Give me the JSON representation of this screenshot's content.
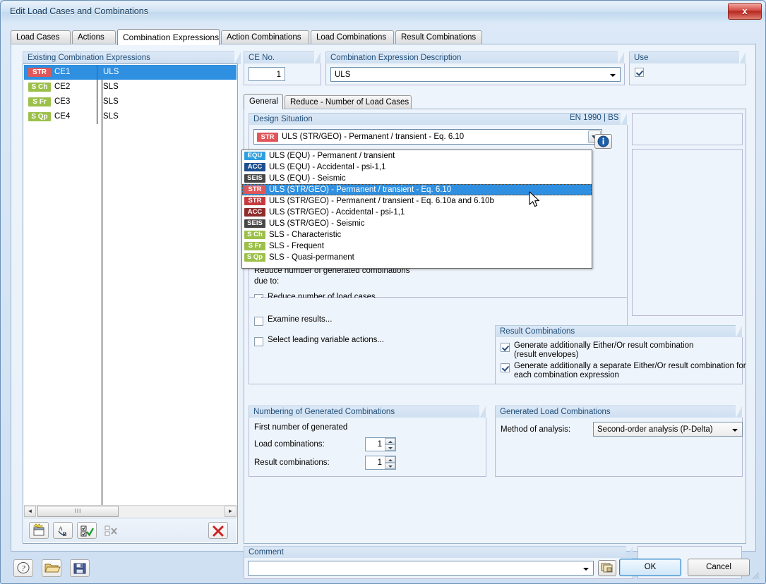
{
  "window": {
    "title": "Edit Load Cases and Combinations",
    "close_label": "x"
  },
  "tabs": [
    {
      "label": "Load Cases",
      "active": false
    },
    {
      "label": "Actions",
      "active": false
    },
    {
      "label": "Combination Expressions",
      "active": true
    },
    {
      "label": "Action Combinations",
      "active": false
    },
    {
      "label": "Load Combinations",
      "active": false
    },
    {
      "label": "Result Combinations",
      "active": false
    }
  ],
  "left_panel": {
    "header": "Existing Combination Expressions",
    "rows": [
      {
        "badge": "STR",
        "badge_color": "#e0575a",
        "name": "CE1",
        "desc": "ULS",
        "selected": true
      },
      {
        "badge": "S Ch",
        "badge_color": "#9cc04a",
        "name": "CE2",
        "desc": "SLS",
        "selected": false
      },
      {
        "badge": "S Fr",
        "badge_color": "#9cc04a",
        "name": "CE3",
        "desc": "SLS",
        "selected": false
      },
      {
        "badge": "S Qp",
        "badge_color": "#9cc04a",
        "name": "CE4",
        "desc": "SLS",
        "selected": false
      }
    ],
    "toolbar": {
      "new_title": "new-combination-expression",
      "rename_title": "rename",
      "select_all_title": "select-all",
      "deselect_all_title": "deselect-all",
      "delete_title": "delete"
    },
    "scrollbar": {
      "left_arrow": "◄",
      "right_arrow": "►",
      "thumb_grip": "III"
    }
  },
  "ce_no": {
    "header": "CE No.",
    "value": "1"
  },
  "description": {
    "header": "Combination Expression Description",
    "value": "ULS"
  },
  "use": {
    "header": "Use",
    "checked": true
  },
  "inner_tabs": [
    {
      "label": "General",
      "active": true
    },
    {
      "label": "Reduce - Number of Load Cases",
      "active": false
    }
  ],
  "design_situation": {
    "header": "Design Situation",
    "standard": "EN 1990 | BS",
    "selected_badge": "STR",
    "selected_badge_color": "#e0575a",
    "selected_value": "ULS (STR/GEO) - Permanent / transient - Eq. 6.10",
    "info_icon": "info-icon",
    "options": [
      {
        "badge": "EQU",
        "badge_color": "#2f9fe0",
        "label": "ULS (EQU) - Permanent / transient",
        "selected": false
      },
      {
        "badge": "ACC",
        "badge_color": "#1c4f8f",
        "label": "ULS (EQU) - Accidental - psi-1,1",
        "selected": false
      },
      {
        "badge": "SEIS",
        "badge_color": "#474747",
        "label": "ULS (EQU) - Seismic",
        "selected": false
      },
      {
        "badge": "STR",
        "badge_color": "#e0575a",
        "label": "ULS (STR/GEO) - Permanent / transient - Eq. 6.10",
        "selected": true
      },
      {
        "badge": "STR",
        "badge_color": "#c33b3f",
        "label": "ULS (STR/GEO) - Permanent / transient - Eq. 6.10a and 6.10b",
        "selected": false
      },
      {
        "badge": "ACC",
        "badge_color": "#8e2b2b",
        "label": "ULS (STR/GEO) - Accidental - psi-1,1",
        "selected": false
      },
      {
        "badge": "SEIS",
        "badge_color": "#474747",
        "label": "ULS (STR/GEO) - Seismic",
        "selected": false
      },
      {
        "badge": "S Ch",
        "badge_color": "#9cc04a",
        "label": "SLS - Characteristic",
        "selected": false
      },
      {
        "badge": "S Fr",
        "badge_color": "#9cc04a",
        "label": "SLS - Frequent",
        "selected": false
      },
      {
        "badge": "S Qp",
        "badge_color": "#9cc04a",
        "label": "SLS - Quasi-permanent",
        "selected": false
      }
    ]
  },
  "reduce": {
    "intro_line1": "Reduce number of generated combinations",
    "intro_line2": "due to:",
    "items": [
      {
        "label": "Reduce number of load cases...",
        "checked": true
      },
      {
        "label": "Examine results...",
        "checked": false
      },
      {
        "label": "Select leading variable actions...",
        "checked": false
      }
    ]
  },
  "result_combinations": {
    "header": "Result Combinations",
    "items": [
      {
        "line1": "Generate additionally Either/Or result combination",
        "line2": "(result envelopes)",
        "checked": true
      },
      {
        "line1": "Generate additionally a separate Either/Or result combination for",
        "line2": "each combination expression",
        "checked": true
      }
    ]
  },
  "numbering": {
    "header": "Numbering of Generated Combinations",
    "intro": "First number of generated",
    "load_label": "Load combinations:",
    "load_value": "1",
    "result_label": "Result combinations:",
    "result_value": "1"
  },
  "generated_load_combinations": {
    "header": "Generated Load Combinations",
    "method_label": "Method of analysis:",
    "method_value": "Second-order analysis (P-Delta)"
  },
  "comment": {
    "header": "Comment",
    "value": "",
    "pick_button": "comment-library-icon"
  },
  "bottom": {
    "help_icon": "help-icon",
    "open_icon": "open-folder-icon",
    "save_icon": "save-disk-icon",
    "ok": "OK",
    "cancel": "Cancel"
  }
}
